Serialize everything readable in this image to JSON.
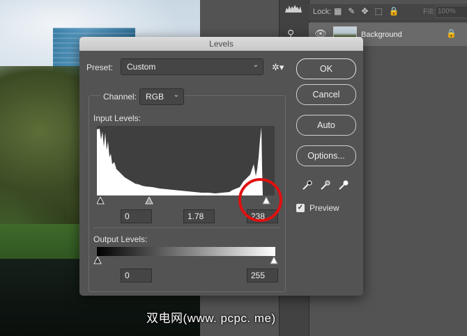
{
  "dialog": {
    "title": "Levels",
    "preset_label": "Preset:",
    "preset_value": "Custom",
    "channel_label": "Channel:",
    "channel_value": "RGB",
    "input_levels_label": "Input Levels:",
    "input_black": "0",
    "input_gamma": "1.78",
    "input_white": "238",
    "output_levels_label": "Output Levels:",
    "output_black": "0",
    "output_white": "255",
    "buttons": {
      "ok": "OK",
      "cancel": "Cancel",
      "auto": "Auto",
      "options": "Options..."
    },
    "preview_label": "Preview",
    "preview_checked": true
  },
  "layers_panel": {
    "lock_label": "Lock:",
    "fill_label": "Fill:",
    "fill_value": "100%",
    "layer_name": "Background"
  },
  "icons": {
    "gear": "gear-icon",
    "eyedroppers": [
      "black-eyedropper-icon",
      "gray-eyedropper-icon",
      "white-eyedropper-icon"
    ],
    "eye": "eye-icon",
    "lock": "lock-icon"
  },
  "colors": {
    "highlight_circle": "#e01010",
    "dialog_bg": "#535353"
  },
  "watermark": "双电网(www. pcpc. me)"
}
